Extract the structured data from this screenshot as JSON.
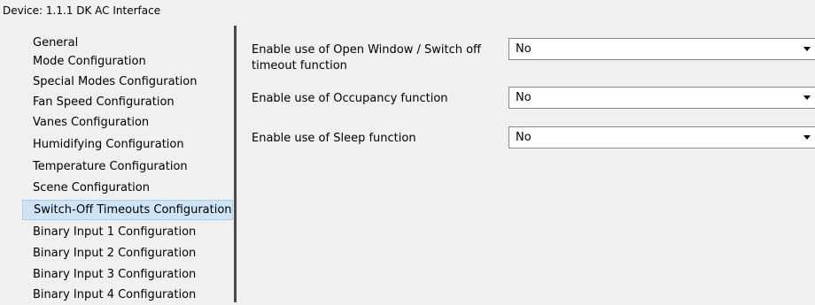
{
  "header": {
    "title": "Device: 1.1.1  DK AC Interface"
  },
  "sidebar": {
    "items": [
      {
        "label": "General"
      },
      {
        "label": "Mode Configuration"
      },
      {
        "label": "Special Modes Configuration"
      },
      {
        "label": "Fan Speed Configuration"
      },
      {
        "label": "Vanes Configuration"
      },
      {
        "label": "Humidifying Configuration"
      },
      {
        "label": "Temperature Configuration"
      },
      {
        "label": "Scene Configuration"
      },
      {
        "label": "Switch-Off Timeouts Configuration",
        "selected": true
      },
      {
        "label": "Binary Input 1 Configuration"
      },
      {
        "label": "Binary Input 2 Configuration"
      },
      {
        "label": "Binary Input 3 Configuration"
      },
      {
        "label": "Binary Input 4 Configuration"
      }
    ]
  },
  "main": {
    "params": [
      {
        "label": "Enable use of Open Window / Switch off timeout function",
        "value": "No"
      },
      {
        "label": "Enable use of Occupancy function",
        "value": "No"
      },
      {
        "label": "Enable use of Sleep function",
        "value": "No"
      }
    ]
  }
}
